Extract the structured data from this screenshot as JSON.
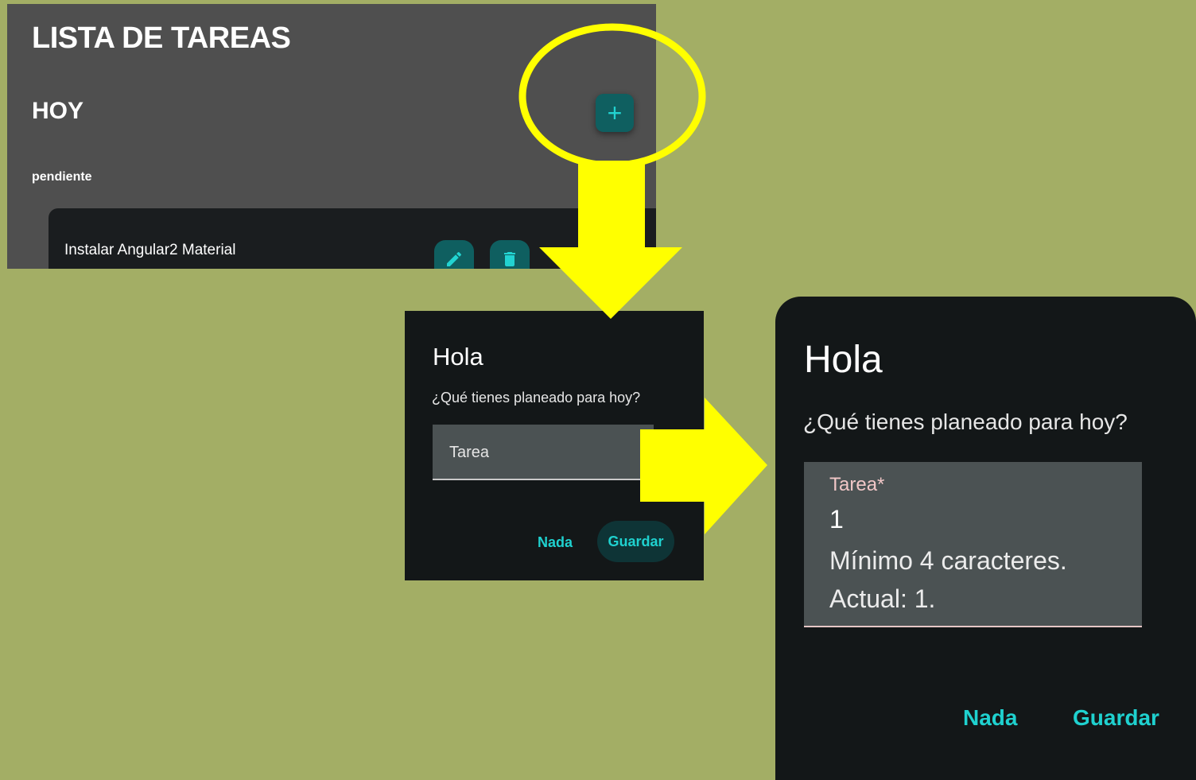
{
  "todo_app": {
    "title": "LISTA DE TAREAS",
    "section": "HOY",
    "status_label": "pendiente",
    "add_button_icon": "plus-icon",
    "tasks": [
      {
        "label": "Instalar Angular2 Material",
        "edit_icon": "pencil-icon",
        "delete_icon": "trash-icon"
      }
    ]
  },
  "dialog_empty": {
    "title": "Hola",
    "subtitle": "¿Qué tienes planeado para hoy?",
    "field_label": "Tarea",
    "cancel_label": "Nada",
    "save_label": "Guardar"
  },
  "dialog_error": {
    "title": "Hola",
    "subtitle": "¿Qué tienes planeado para hoy?",
    "field_label": "Tarea*",
    "field_value": "1",
    "error_message": "Mínimo 4 caracteres. Actual: 1.",
    "cancel_label": "Nada",
    "save_label": "Guardar"
  },
  "colors": {
    "background": "#a3ae65",
    "accent": "#1fd1cf",
    "annotation": "#ffff00",
    "error_label": "#f1c7c7"
  }
}
